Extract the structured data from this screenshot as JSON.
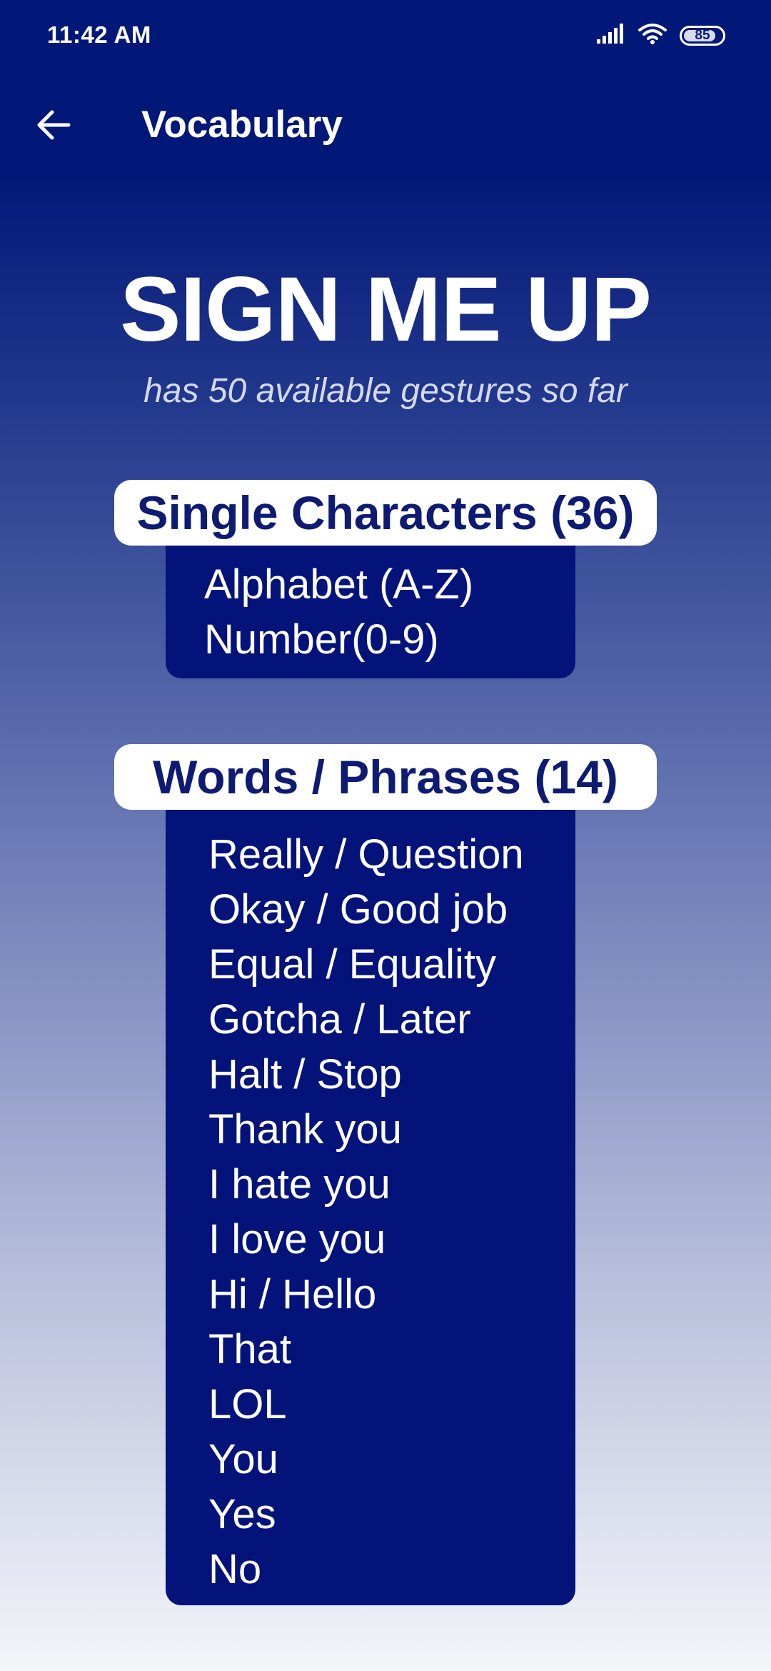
{
  "status_bar": {
    "time": "11:42 AM",
    "battery": "85",
    "battery_level_percent": 85,
    "icons": [
      "signal-icon",
      "wifi-icon",
      "battery-icon"
    ]
  },
  "app_bar": {
    "title": "Vocabulary",
    "back_icon": "arrow-left-icon"
  },
  "hero": {
    "title": "SIGN ME UP",
    "subtitle": "has 50 available gestures so far"
  },
  "sections": [
    {
      "header": "Single Characters (36)",
      "items": [
        "Alphabet (A-Z)",
        "Number(0-9)"
      ]
    },
    {
      "header": "Words / Phrases (14)",
      "items": [
        "Really / Question",
        "Okay / Good job",
        "Equal / Equality",
        "Gotcha / Later",
        "Halt / Stop",
        "Thank you",
        "I hate you",
        "I love you",
        "Hi / Hello",
        "That",
        "LOL",
        "You",
        "Yes",
        "No"
      ]
    }
  ],
  "colors": {
    "header_bg": "#021878",
    "card_bg": "#03137a",
    "header_text": "#0e1b73",
    "gradient_bottom": "#f4f5f9"
  }
}
